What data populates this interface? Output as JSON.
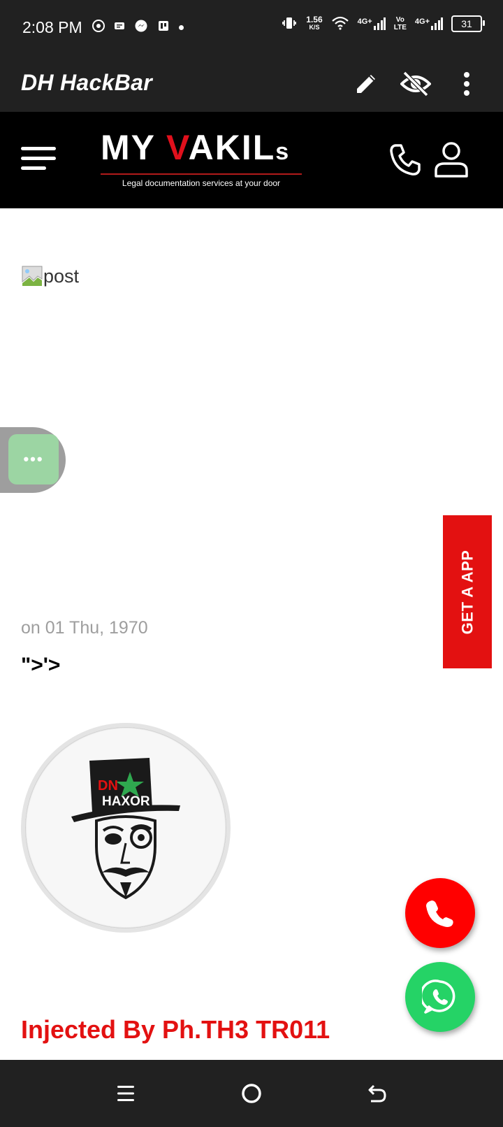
{
  "status_bar": {
    "time": "2:08 PM",
    "speed_value": "1.56",
    "speed_unit": "K/S",
    "network1": "4G+",
    "volte_top": "Vo",
    "volte_bottom": "LTE",
    "network2": "4G+",
    "battery": "31"
  },
  "app_bar": {
    "title": "DH HackBar",
    "icons": [
      "edit-icon",
      "visibility-off-icon",
      "more-vert-icon"
    ]
  },
  "site_header": {
    "logo_text_my": "MY ",
    "logo_text_v": "V",
    "logo_text_akil": "AKIL",
    "logo_text_s": "s",
    "logo_tagline": "Legal documentation services at your door"
  },
  "post": {
    "image_alt": "post",
    "date": "on 01 Thu, 1970",
    "title": "\">'>",
    "injected_text": "Injected By Ph.TH3 TR011",
    "avatar_logo_dn": "DN",
    "avatar_logo_haxor": "HAXOR"
  },
  "floating": {
    "get_app_label": "GET A APP",
    "menu_label": "•••"
  },
  "colors": {
    "bar_bg": "#212121",
    "header_bg": "#000000",
    "brand_red": "#e31111",
    "whatsapp_green": "#25d366",
    "fab_menu_green": "#9cd5a3"
  }
}
